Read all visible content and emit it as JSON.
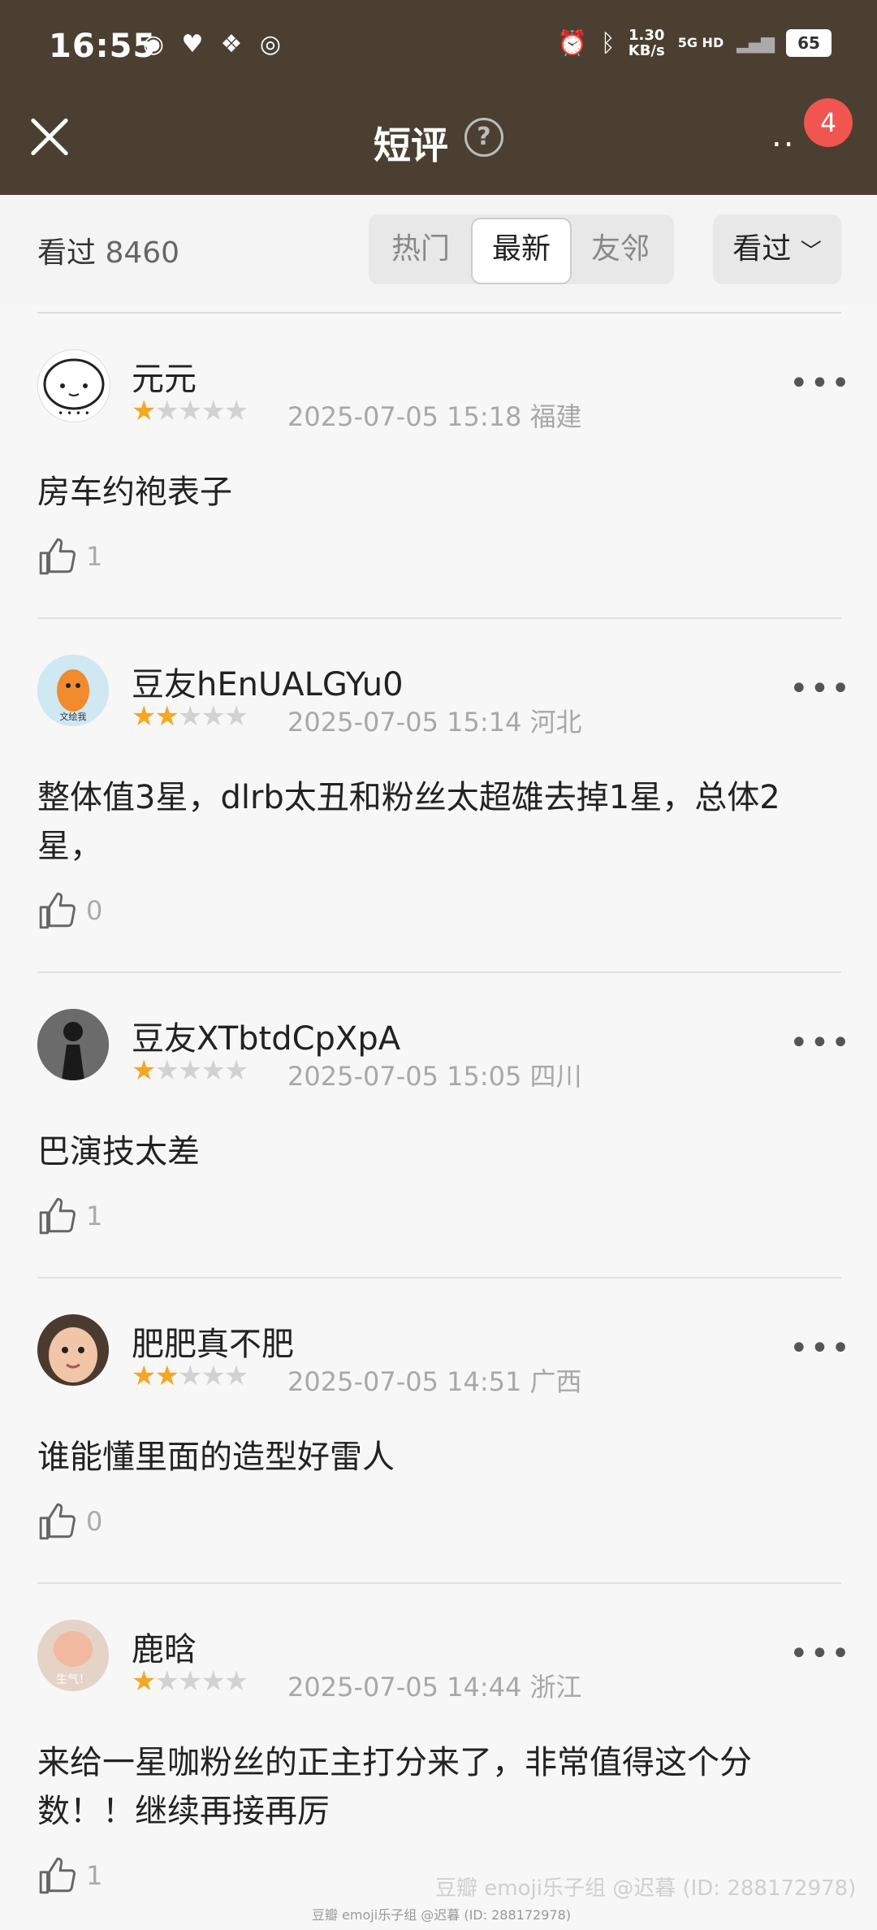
{
  "status_bar": {
    "time": "16:55",
    "speed": "1.30",
    "speed_unit": "KB/s",
    "network": "5G HD",
    "battery": "65"
  },
  "nav": {
    "title": "短评",
    "help": "?",
    "more": "..",
    "badge": "4"
  },
  "filter": {
    "seen_label": "看过",
    "seen_count": "8460",
    "tabs": [
      {
        "label": "热门"
      },
      {
        "label": "最新"
      },
      {
        "label": "友邻"
      }
    ],
    "active_tab": "最新",
    "dropdown": "看过"
  },
  "comments": [
    {
      "user": "元元",
      "stars": 1,
      "stars_on": "★",
      "stars_off": "★★★★",
      "time": "2025-07-05 15:18",
      "region": "福建",
      "text": "房车约袍表子",
      "likes": "1"
    },
    {
      "user": "豆友hEnUALGYu0",
      "stars": 2,
      "stars_on": "★★",
      "stars_off": "★★★",
      "time": "2025-07-05 15:14",
      "region": "河北",
      "text": "整体值3星，dlrb太丑和粉丝太超雄去掉1星，总体2星，",
      "likes": "0"
    },
    {
      "user": "豆友XTbtdCpXpA",
      "stars": 1,
      "stars_on": "★",
      "stars_off": "★★★★",
      "time": "2025-07-05 15:05",
      "region": "四川",
      "text": "巴演技太差",
      "likes": "1"
    },
    {
      "user": "肥肥真不肥",
      "stars": 2,
      "stars_on": "★★",
      "stars_off": "★★★",
      "time": "2025-07-05 14:51",
      "region": "广西",
      "text": "谁能懂里面的造型好雷人",
      "likes": "0"
    },
    {
      "user": "鹿晗",
      "stars": 1,
      "stars_on": "★",
      "stars_off": "★★★★",
      "time": "2025-07-05 14:44",
      "region": "浙江",
      "text": "来给一星咖粉丝的正主打分来了，非常值得这个分数！！继续再接再厉",
      "likes": "1"
    }
  ],
  "avatar_texts": {
    "c1": "文绘我",
    "c4": "生气！"
  },
  "watermark": "豆瓣  emoji乐子组 @迟暮 (ID: 288172978)",
  "watermark_small": "豆瓣  emoji乐子组 @迟暮 (ID: 288172978)",
  "colors": {
    "header_bg": "#4a3f31",
    "star_on": "#f5a623",
    "badge": "#f0554f"
  }
}
